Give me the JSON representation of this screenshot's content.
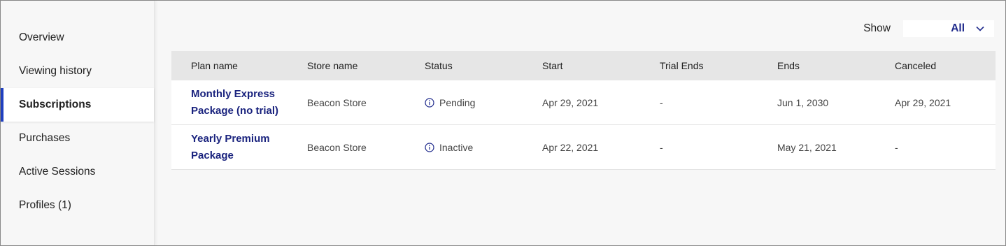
{
  "sidebar": {
    "items": [
      {
        "label": "Overview",
        "active": false
      },
      {
        "label": "Viewing history",
        "active": false
      },
      {
        "label": "Subscriptions",
        "active": true
      },
      {
        "label": "Purchases",
        "active": false
      },
      {
        "label": "Active Sessions",
        "active": false
      },
      {
        "label": "Profiles (1)",
        "active": false
      }
    ]
  },
  "filter": {
    "label": "Show",
    "value": "All",
    "icon": "chevron-down-icon"
  },
  "table": {
    "columns": [
      "Plan name",
      "Store name",
      "Status",
      "Start",
      "Trial Ends",
      "Ends",
      "Canceled"
    ],
    "rows": [
      {
        "plan_line1": "Monthly Express",
        "plan_line2": "Package (no trial)",
        "store": "Beacon Store",
        "status": "Pending",
        "start": "Apr 29, 2021",
        "trial_ends": "-",
        "ends": "Jun 1, 2030",
        "canceled": "Apr 29, 2021"
      },
      {
        "plan_line1": "Yearly Premium",
        "plan_line2": "Package",
        "store": "Beacon Store",
        "status": "Inactive",
        "start": "Apr 22, 2021",
        "trial_ends": "-",
        "ends": "May 21, 2021",
        "canceled": "-"
      }
    ]
  },
  "colors": {
    "accent": "#1f3fbf",
    "link": "#1a237e",
    "header_bg": "#e6e6e6"
  }
}
